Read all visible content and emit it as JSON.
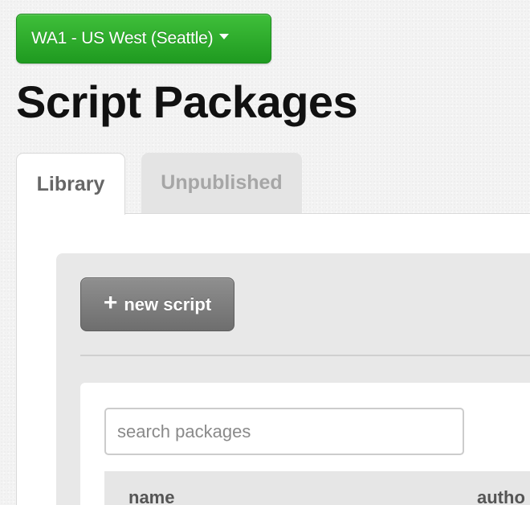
{
  "region": {
    "label": "WA1 - US West (Seattle)",
    "caret_icon": "caret-down-icon"
  },
  "page": {
    "title": "Script Packages"
  },
  "tabs": [
    {
      "label": "Library",
      "active": true
    },
    {
      "label": "Unpublished",
      "active": false
    }
  ],
  "toolbar": {
    "new_script_label": "new script",
    "new_script_icon": "plus-icon"
  },
  "search": {
    "placeholder": "search packages",
    "value": ""
  },
  "table": {
    "columns": [
      "name",
      "autho"
    ]
  },
  "colors": {
    "region_button": "#2aa82b",
    "new_script_button": "#7c7c7c"
  }
}
